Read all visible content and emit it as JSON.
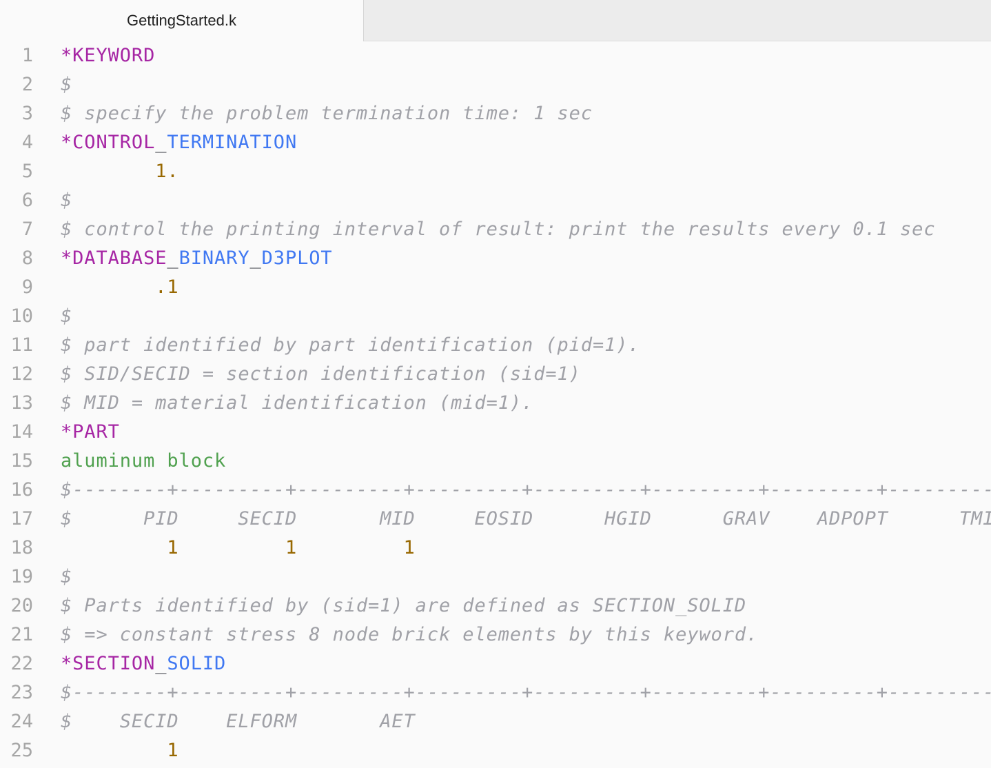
{
  "tab": {
    "title": "GettingStarted.k"
  },
  "lines": [
    {
      "n": "1",
      "segs": [
        {
          "c": "kw",
          "t": "*KEYWORD"
        }
      ]
    },
    {
      "n": "2",
      "segs": [
        {
          "c": "cm",
          "t": "$"
        }
      ]
    },
    {
      "n": "3",
      "segs": [
        {
          "c": "cm",
          "t": "$ specify the problem termination time: 1 sec"
        }
      ]
    },
    {
      "n": "4",
      "segs": [
        {
          "c": "kw",
          "t": "*CONTROL"
        },
        {
          "c": "us",
          "t": "_"
        },
        {
          "c": "kw2",
          "t": "TERMINATION"
        }
      ]
    },
    {
      "n": "5",
      "segs": [
        {
          "c": "pl",
          "t": "        "
        },
        {
          "c": "num",
          "t": "1."
        }
      ]
    },
    {
      "n": "6",
      "segs": [
        {
          "c": "cm",
          "t": "$"
        }
      ]
    },
    {
      "n": "7",
      "segs": [
        {
          "c": "cm",
          "t": "$ control the printing interval of result: print the results every 0.1 sec"
        }
      ]
    },
    {
      "n": "8",
      "segs": [
        {
          "c": "kw",
          "t": "*DATABASE"
        },
        {
          "c": "us",
          "t": "_"
        },
        {
          "c": "kw2",
          "t": "BINARY"
        },
        {
          "c": "us",
          "t": "_"
        },
        {
          "c": "kw2",
          "t": "D3PLOT"
        }
      ]
    },
    {
      "n": "9",
      "segs": [
        {
          "c": "pl",
          "t": "        "
        },
        {
          "c": "num",
          "t": ".1"
        }
      ]
    },
    {
      "n": "10",
      "segs": [
        {
          "c": "cm",
          "t": "$"
        }
      ]
    },
    {
      "n": "11",
      "segs": [
        {
          "c": "cm",
          "t": "$ part identified by part identification (pid=1)."
        }
      ]
    },
    {
      "n": "12",
      "segs": [
        {
          "c": "cm",
          "t": "$ SID/SECID = section identification (sid=1)"
        }
      ]
    },
    {
      "n": "13",
      "segs": [
        {
          "c": "cm",
          "t": "$ MID = material identification (mid=1)."
        }
      ]
    },
    {
      "n": "14",
      "segs": [
        {
          "c": "kw",
          "t": "*PART"
        }
      ]
    },
    {
      "n": "15",
      "segs": [
        {
          "c": "str",
          "t": "aluminum block"
        }
      ]
    },
    {
      "n": "16",
      "segs": [
        {
          "c": "cm",
          "t": "$--------+---------+---------+---------+---------+---------+---------+---------+"
        }
      ]
    },
    {
      "n": "17",
      "segs": [
        {
          "c": "cm",
          "t": "$      PID     SECID       MID     EOSID      HGID      GRAV    ADPOPT      TMID"
        }
      ]
    },
    {
      "n": "18",
      "segs": [
        {
          "c": "pl",
          "t": "         "
        },
        {
          "c": "num",
          "t": "1"
        },
        {
          "c": "pl",
          "t": "         "
        },
        {
          "c": "num",
          "t": "1"
        },
        {
          "c": "pl",
          "t": "         "
        },
        {
          "c": "num",
          "t": "1"
        }
      ]
    },
    {
      "n": "19",
      "segs": [
        {
          "c": "cm",
          "t": "$"
        }
      ]
    },
    {
      "n": "20",
      "segs": [
        {
          "c": "cm",
          "t": "$ Parts identified by (sid=1) are defined as SECTION_SOLID"
        }
      ]
    },
    {
      "n": "21",
      "segs": [
        {
          "c": "cm",
          "t": "$ => constant stress 8 node brick elements by this keyword."
        }
      ]
    },
    {
      "n": "22",
      "segs": [
        {
          "c": "kw",
          "t": "*SECTION"
        },
        {
          "c": "us",
          "t": "_"
        },
        {
          "c": "kw2",
          "t": "SOLID"
        }
      ]
    },
    {
      "n": "23",
      "segs": [
        {
          "c": "cm",
          "t": "$--------+---------+---------+---------+---------+---------+---------+---------+"
        }
      ]
    },
    {
      "n": "24",
      "segs": [
        {
          "c": "cm",
          "t": "$    SECID    ELFORM       AET"
        }
      ]
    },
    {
      "n": "25",
      "segs": [
        {
          "c": "pl",
          "t": "         "
        },
        {
          "c": "num",
          "t": "1"
        }
      ]
    }
  ]
}
